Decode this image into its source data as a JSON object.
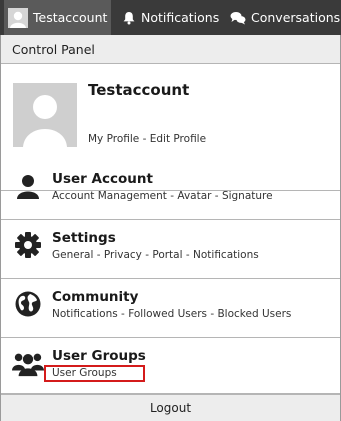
{
  "topbar": {
    "account_label": "Testaccount",
    "notifications_label": "Notifications",
    "conversations_label": "Conversations"
  },
  "panel": {
    "header": "Control Panel",
    "profile": {
      "name": "Testaccount",
      "my_profile": "My Profile",
      "separator": " - ",
      "edit_profile": "Edit Profile"
    },
    "sections": [
      {
        "title": "User Account",
        "icon": "user-icon",
        "links": [
          "Account Management",
          "Avatar",
          "Signature"
        ]
      },
      {
        "title": "Settings",
        "icon": "gear-icon",
        "links": [
          "General",
          "Privacy",
          "Portal",
          "Notifications"
        ]
      },
      {
        "title": "Community",
        "icon": "globe-icon",
        "links": [
          "Notifications",
          "Followed Users",
          "Blocked Users"
        ]
      },
      {
        "title": "User Groups",
        "icon": "users-icon",
        "links": [
          "User Groups"
        ]
      }
    ],
    "logout": "Logout"
  },
  "colors": {
    "topbar_bg": "#3a3a3a",
    "account_tab_bg": "#5a5a5a",
    "header_bg": "#ededed",
    "highlight": "#d41b1b"
  }
}
